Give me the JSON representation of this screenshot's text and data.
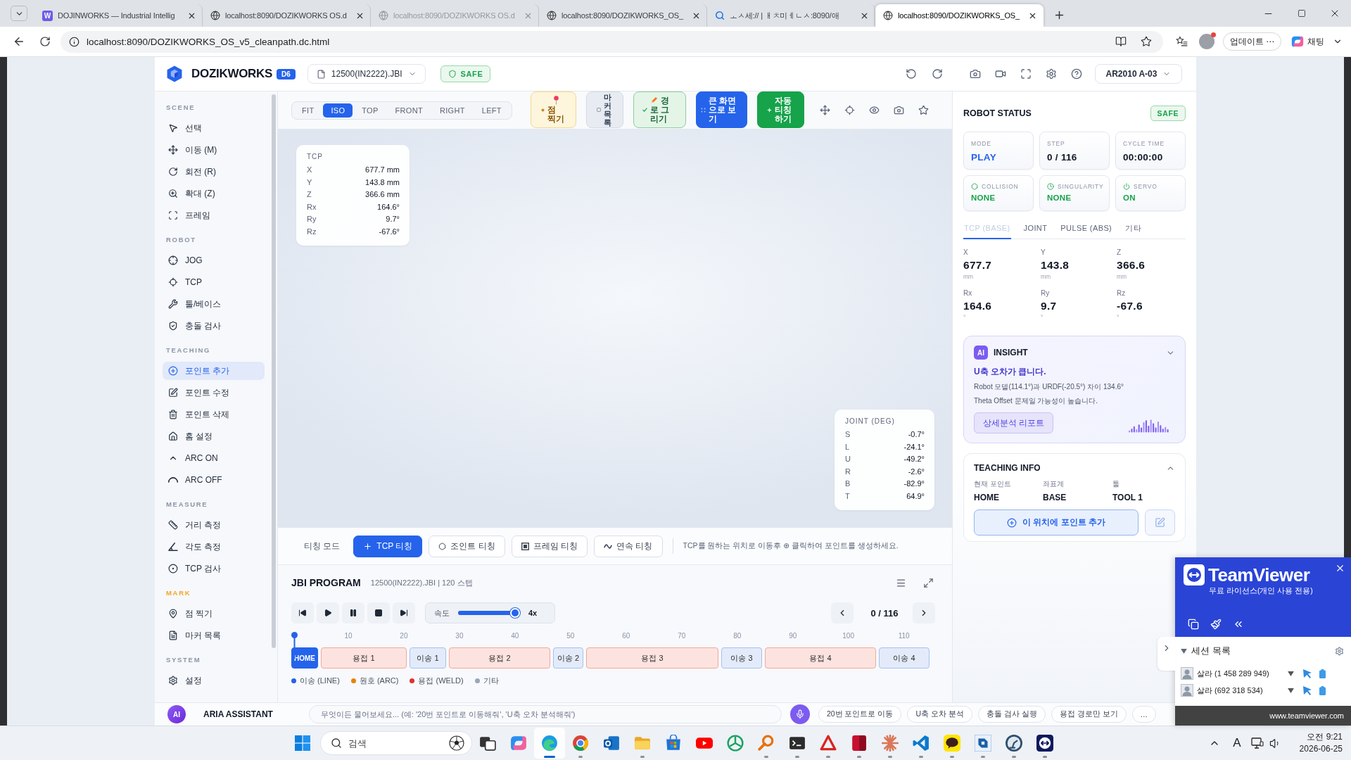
{
  "browser": {
    "tabs": [
      {
        "title": "DOJINWORKS — Industrial Intellig",
        "kind": "app",
        "favicon": "W",
        "selected": false,
        "sleeping": false
      },
      {
        "title": "localhost:8090/DOZIKWORKS OS.d",
        "kind": "page",
        "selected": false,
        "sleeping": false
      },
      {
        "title": "localhost:8090/DOZIKWORKS OS.d",
        "kind": "page",
        "selected": false,
        "sleeping": true
      },
      {
        "title": "localhost:8090/DOZIKWORKS_OS_",
        "kind": "page",
        "selected": false,
        "sleeping": false
      },
      {
        "title": "ㅗㅅ세:// | ㅐㅊ미ㅔㄴㅅ:8090/애",
        "kind": "search",
        "selected": false,
        "sleeping": false
      },
      {
        "title": "localhost:8090/DOZIKWORKS_OS_",
        "kind": "page",
        "selected": true,
        "sleeping": false
      }
    ],
    "address": "localhost:8090/DOZIKWORKS_OS_v5_cleanpath.dc.html",
    "update_button": "업데이트 ⋯",
    "chat_button": "채팅"
  },
  "app": {
    "logo": "DOZIKWORKS",
    "version": "D6",
    "file": "12500(IN2222).JBI",
    "status": "SAFE",
    "robot": "AR2010 A-03"
  },
  "sidebar": {
    "sections": [
      {
        "title": "SCENE",
        "color": "#8b95a7",
        "items": [
          {
            "label": "선택",
            "selected": false
          },
          {
            "label": "이동 (M)",
            "selected": false
          },
          {
            "label": "회전 (R)",
            "selected": false
          },
          {
            "label": "확대 (Z)",
            "selected": false
          },
          {
            "label": "프레임",
            "selected": false
          }
        ]
      },
      {
        "title": "ROBOT",
        "color": "#8b95a7",
        "items": [
          {
            "label": "JOG",
            "selected": false
          },
          {
            "label": "TCP",
            "selected": false
          },
          {
            "label": "툴/베이스",
            "selected": false
          },
          {
            "label": "충돌 검사",
            "selected": false
          }
        ]
      },
      {
        "title": "TEACHING",
        "color": "#8b95a7",
        "items": [
          {
            "label": "포인트 추가",
            "selected": true
          },
          {
            "label": "포인트 수정",
            "selected": false
          },
          {
            "label": "포인트 삭제",
            "selected": false
          },
          {
            "label": "홈 설정",
            "selected": false
          },
          {
            "label": "ARC ON",
            "selected": false
          },
          {
            "label": "ARC OFF",
            "selected": false
          }
        ]
      },
      {
        "title": "MEASURE",
        "color": "#8b95a7",
        "items": [
          {
            "label": "거리 측정",
            "selected": false
          },
          {
            "label": "각도 측정",
            "selected": false
          },
          {
            "label": "TCP 검사",
            "selected": false
          }
        ]
      },
      {
        "title": "MARK",
        "color": "#f5a623",
        "items": [
          {
            "label": "점 찍기",
            "selected": false
          },
          {
            "label": "마커 목록",
            "selected": false
          }
        ]
      },
      {
        "title": "SYSTEM",
        "color": "#8b95a7",
        "items": [
          {
            "label": "설정",
            "selected": false
          }
        ]
      }
    ]
  },
  "toolbar": {
    "views": [
      {
        "label": "FIT",
        "selected": false
      },
      {
        "label": "ISO",
        "selected": true
      },
      {
        "label": "TOP",
        "selected": false
      },
      {
        "label": "FRONT",
        "selected": false
      },
      {
        "label": "RIGHT",
        "selected": false
      },
      {
        "label": "LEFT",
        "selected": false
      }
    ],
    "actions": [
      {
        "label": "점 찍기",
        "kind": "mark"
      },
      {
        "label": "마커 목록",
        "kind": "list"
      },
      {
        "label": "경로 그리기",
        "kind": "draw"
      },
      {
        "label": "큰 화면으로 보기",
        "kind": "expand"
      },
      {
        "label": "자동 티칭 하기",
        "kind": "auto"
      }
    ]
  },
  "viewport": {
    "tcp": {
      "title": "TCP",
      "rows": [
        {
          "axis": "X",
          "value": "677.7 mm"
        },
        {
          "axis": "Y",
          "value": "143.8 mm"
        },
        {
          "axis": "Z",
          "value": "366.6 mm"
        },
        {
          "axis": "Rx",
          "value": "164.6°"
        },
        {
          "axis": "Ry",
          "value": "9.7°"
        },
        {
          "axis": "Rz",
          "value": "-67.6°"
        }
      ]
    },
    "joint": {
      "title": "JOINT (DEG)",
      "rows": [
        {
          "axis": "S",
          "value": "-0.7°"
        },
        {
          "axis": "L",
          "value": "-24.1°"
        },
        {
          "axis": "U",
          "value": "-49.2°"
        },
        {
          "axis": "R",
          "value": "-2.6°"
        },
        {
          "axis": "B",
          "value": "-82.9°"
        },
        {
          "axis": "T",
          "value": "64.9°"
        }
      ]
    }
  },
  "teaching": {
    "label": "티칭 모드",
    "modes": [
      {
        "label": "TCP 티칭",
        "selected": true
      },
      {
        "label": "조인트 티칭",
        "selected": false
      },
      {
        "label": "프레임 티칭",
        "selected": false
      },
      {
        "label": "연속 티칭",
        "selected": false
      }
    ],
    "hint": "TCP를 원하는 위치로 이동후 ⊕ 클릭하여 포인트를 생성하세요."
  },
  "program": {
    "title": "JBI PROGRAM",
    "subtitle": "12500(IN2222).JBI | 120 스텝",
    "speed": {
      "label": "속도",
      "level": 0.92,
      "reading": "4x"
    },
    "step": "0 / 116",
    "ruler": [
      "10",
      "20",
      "30",
      "40",
      "50",
      "60",
      "70",
      "80",
      "90",
      "100",
      "110"
    ],
    "playhead": {
      "level": 0
    },
    "segments": [
      {
        "label": "HOME",
        "kind": "home"
      },
      {
        "label": "용접 1",
        "kind": "weld"
      },
      {
        "label": "이송 1",
        "kind": "move"
      },
      {
        "label": "용접 2",
        "kind": "weld"
      },
      {
        "label": "이송 2",
        "kind": "move"
      },
      {
        "label": "용접 3",
        "kind": "weld"
      },
      {
        "label": "이송 3",
        "kind": "move"
      },
      {
        "label": "용접 4",
        "kind": "weld"
      },
      {
        "label": "이송 4",
        "kind": "move"
      }
    ],
    "legend": [
      {
        "label": "이송 (LINE)",
        "color": "#2563eb"
      },
      {
        "label": "원호 (ARC)",
        "color": "#e8830c"
      },
      {
        "label": "용접 (WELD)",
        "color": "#e03131"
      },
      {
        "label": "기타",
        "color": "#9aa5b8"
      }
    ]
  },
  "status": {
    "title": "ROBOT STATUS",
    "badge": "SAFE",
    "stats": [
      {
        "label": "MODE",
        "value": "PLAY",
        "color": "#2563eb"
      },
      {
        "label": "STEP",
        "value": "0 / 116",
        "color": "#111827"
      },
      {
        "label": "CYCLE TIME",
        "value": "00:00:00",
        "color": "#111827"
      }
    ],
    "checks": [
      {
        "label": "COLLISION",
        "value": "NONE",
        "ok": true
      },
      {
        "label": "SINGULARITY",
        "value": "NONE",
        "ok": true
      },
      {
        "label": "SERVO",
        "value": "ON",
        "ok": true
      }
    ],
    "tabs": [
      {
        "label": "TCP (BASE)",
        "selected": true
      },
      {
        "label": "JOINT",
        "selected": false
      },
      {
        "label": "PULSE (ABS)",
        "selected": false
      },
      {
        "label": "기타",
        "selected": false
      }
    ],
    "values": [
      {
        "axis": "X",
        "value": "677.7",
        "unit": "mm"
      },
      {
        "axis": "Y",
        "value": "143.8",
        "unit": "mm"
      },
      {
        "axis": "Z",
        "value": "366.6",
        "unit": "mm"
      },
      {
        "axis": "Rx",
        "value": "164.6",
        "unit": "°"
      },
      {
        "axis": "Ry",
        "value": "9.7",
        "unit": "°"
      },
      {
        "axis": "Rz",
        "value": "-67.6",
        "unit": "°"
      }
    ]
  },
  "insight": {
    "badge": "AI",
    "title": "INSIGHT",
    "headline": "U축 오차가 큽니다.",
    "lines": [
      "Robot 모델(114.1°)과 URDF(-20.5°) 차이 134.6°",
      "Theta Offset 문제일 가능성이 높습니다."
    ],
    "button": "상세분석 리포트"
  },
  "teaching_info": {
    "title": "TEACHING INFO",
    "fields": [
      {
        "label": "현재 포인트",
        "value": "HOME"
      },
      {
        "label": "좌표계",
        "value": "BASE"
      },
      {
        "label": "툴",
        "value": "TOOL 1"
      }
    ],
    "button": "이 위치에 포인트 추가"
  },
  "assistant": {
    "badge": "AI",
    "title": "ARIA ASSISTANT",
    "placeholder": "무엇이든 물어보세요... (예: '20번 포인트로 이동해줘', 'U축 오차 분석해줘')",
    "chips": [
      "20번 포인트로 이동",
      "U축 오차 분석",
      "충돌 검사 실행",
      "용접 경로만 보기",
      "…"
    ]
  },
  "teamviewer": {
    "brand": "TeamViewer",
    "license": "무료 라이선스(개인 사용 전용)",
    "section": "세션 목록",
    "sessions": [
      "살라 (1 458 289 949)",
      "살라 (692 318 534)"
    ],
    "footer": "www.teamviewer.com"
  },
  "taskbar": {
    "search": {
      "placeholder": "검색"
    },
    "apps": [
      {
        "kind": "taskview",
        "running": false,
        "active": false
      },
      {
        "kind": "swirl",
        "running": false,
        "active": false
      },
      {
        "kind": "wave",
        "running": true,
        "active": true
      },
      {
        "kind": "ring",
        "running": true,
        "active": false
      },
      {
        "kind": "mail",
        "running": false,
        "active": false
      },
      {
        "kind": "folder",
        "running": true,
        "active": false
      },
      {
        "kind": "bag",
        "running": false,
        "active": false
      },
      {
        "kind": "play",
        "running": false,
        "active": false
      },
      {
        "kind": "spokes",
        "running": false,
        "active": false
      },
      {
        "kind": "magnifier",
        "running": true,
        "active": false
      },
      {
        "kind": "terminal",
        "running": true,
        "active": false
      },
      {
        "kind": "triangle",
        "running": true,
        "active": false
      },
      {
        "kind": "tile",
        "running": true,
        "active": false
      },
      {
        "kind": "starburst",
        "running": true,
        "active": false
      },
      {
        "kind": "ribbon",
        "running": true,
        "active": false
      },
      {
        "kind": "bubble",
        "running": true,
        "active": false
      },
      {
        "kind": "layers",
        "running": true,
        "active": false
      },
      {
        "kind": "robot",
        "running": true,
        "active": false
      },
      {
        "kind": "arrows",
        "running": true,
        "active": false
      }
    ],
    "ime": "A",
    "time": "오전 9:21",
    "date": "2026-06-25"
  }
}
